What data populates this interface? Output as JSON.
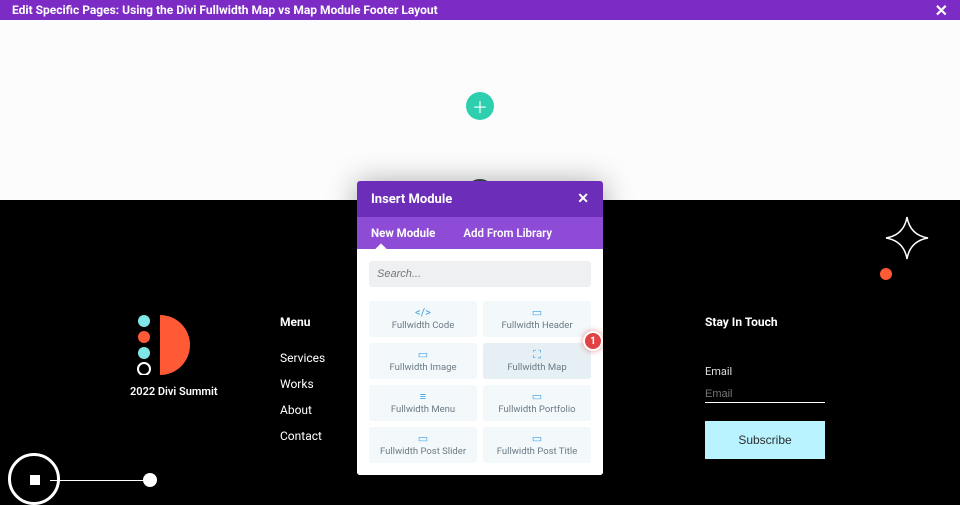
{
  "topbar": {
    "title": "Edit Specific Pages: Using the Divi Fullwidth Map vs Map Module Footer Layout",
    "close_glyph": "✕"
  },
  "canvas": {
    "plus_glyph": "＋"
  },
  "footer": {
    "logo_caption": "2022 Divi Summit",
    "menu": {
      "heading": "Menu",
      "items": [
        "Services",
        "Works",
        "About",
        "Contact"
      ]
    },
    "stay": {
      "heading": "Stay In Touch",
      "email_label": "Email",
      "subscribe_label": "Subscribe"
    }
  },
  "modal": {
    "title": "Insert Module",
    "close_glyph": "✕",
    "tabs": {
      "new": "New Module",
      "library": "Add From Library"
    },
    "search_placeholder": "Search...",
    "callout": "1",
    "items": [
      {
        "icon": "</>",
        "label": "Fullwidth Code"
      },
      {
        "icon": "▭",
        "label": "Fullwidth Header"
      },
      {
        "icon": "▭",
        "label": "Fullwidth Image"
      },
      {
        "icon": "⛶",
        "label": "Fullwidth Map",
        "highlight": true
      },
      {
        "icon": "≡",
        "label": "Fullwidth Menu"
      },
      {
        "icon": "▭",
        "label": "Fullwidth Portfolio"
      },
      {
        "icon": "▭",
        "label": "Fullwidth Post Slider"
      },
      {
        "icon": "▭",
        "label": "Fullwidth Post Title"
      }
    ]
  },
  "colors": {
    "accent_purple": "#7c2bc4",
    "accent_coral": "#ff5a36",
    "accent_cyan": "#2ecfae"
  }
}
